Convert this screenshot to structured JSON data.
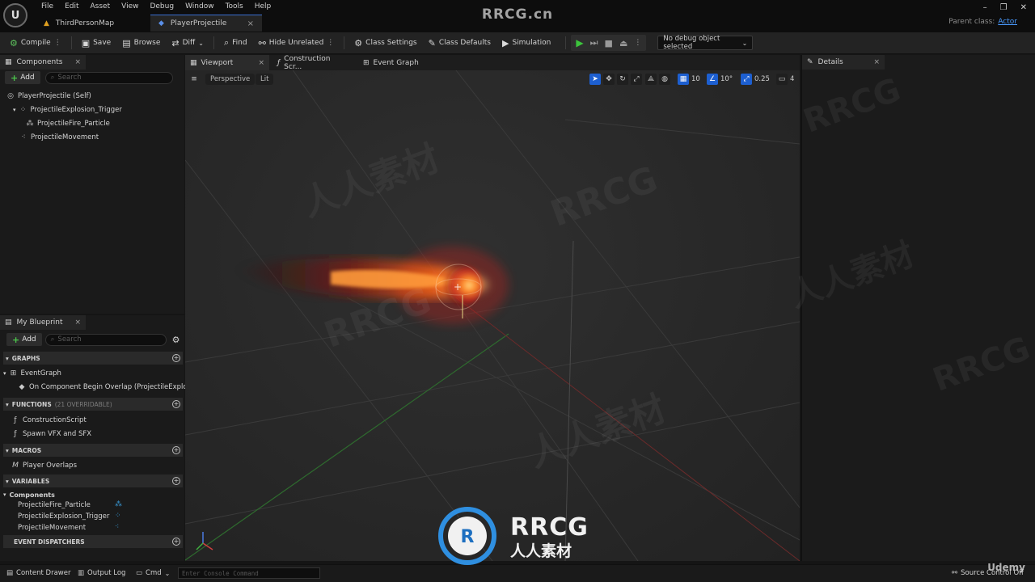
{
  "window": {
    "menu": [
      "File",
      "Edit",
      "Asset",
      "View",
      "Debug",
      "Window",
      "Tools",
      "Help"
    ],
    "tabs": [
      {
        "label": "ThirdPersonMap"
      },
      {
        "label": "PlayerProjectile"
      }
    ],
    "parent_class_label": "Parent class:",
    "parent_class_value": "Actor"
  },
  "toolbar": {
    "compile": "Compile",
    "save": "Save",
    "browse": "Browse",
    "diff": "Diff",
    "find": "Find",
    "hide_unrelated": "Hide Unrelated",
    "class_settings": "Class Settings",
    "class_defaults": "Class Defaults",
    "simulation": "Simulation",
    "debug_object": "No debug object selected"
  },
  "components": {
    "tab": "Components",
    "add": "Add",
    "search_placeholder": "Search",
    "items": [
      {
        "label": "PlayerProjectile (Self)"
      },
      {
        "label": "ProjectileExplosion_Trigger"
      },
      {
        "label": "ProjectileFire_Particle"
      },
      {
        "label": "ProjectileMovement"
      }
    ]
  },
  "my_blueprint": {
    "tab": "My Blueprint",
    "add": "Add",
    "search_placeholder": "Search",
    "graphs_header": "GRAPHS",
    "graphs": [
      "EventGraph",
      "On Component Begin Overlap (ProjectileExplosion"
    ],
    "functions_header": "FUNCTIONS",
    "functions_hint": "(21 OVERRIDABLE)",
    "functions": [
      "ConstructionScript",
      "Spawn VFX and SFX"
    ],
    "macros_header": "MACROS",
    "macros": [
      "Player Overlaps"
    ],
    "variables_header": "VARIABLES",
    "variables_group": "Components",
    "variables": [
      "ProjectileFire_Particle",
      "ProjectileExplosion_Trigger",
      "ProjectileMovement"
    ],
    "dispatchers_header": "EVENT DISPATCHERS"
  },
  "viewport": {
    "tabs": [
      "Viewport",
      "Construction Scr...",
      "Event Graph"
    ],
    "view_mode": "Perspective",
    "lighting": "Lit",
    "grid_snap": "10",
    "rotation_snap": "10°",
    "scale_snap": "0.25",
    "camera_speed": "4"
  },
  "details": {
    "tab": "Details"
  },
  "statusbar": {
    "content_drawer": "Content Drawer",
    "output_log": "Output Log",
    "cmd": "Cmd",
    "console_placeholder": "Enter Console Command",
    "source_control": "Source Control Off"
  },
  "watermarks": {
    "top": "RRCG.cn",
    "logo_main": "RRCG",
    "logo_sub": "人人素材",
    "udemy": "Udemy"
  },
  "colors": {
    "accent_blue": "#1d5fd0",
    "play_green": "#3cc43c",
    "fire_core": "#ffb040",
    "fire_outer": "#d8281a"
  }
}
